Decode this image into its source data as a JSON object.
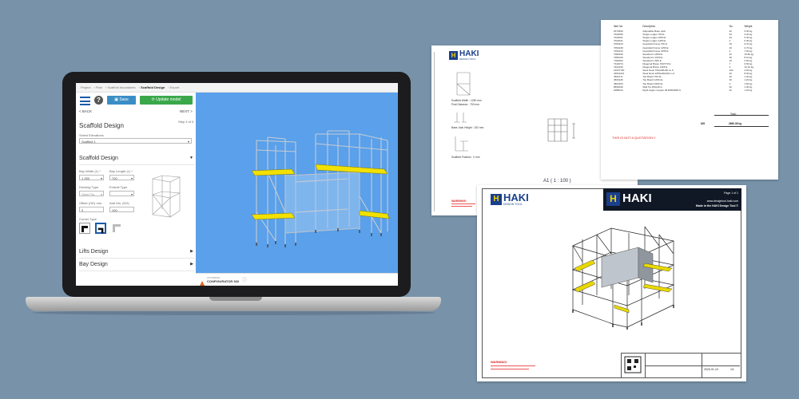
{
  "colors": {
    "background": "#7892a9",
    "viewport": "#5aa0ea",
    "save": "#3a8ec6",
    "update": "#3aa84a",
    "scaffold_yellow": "#f2e000",
    "haki_blue": "#1a3f8c"
  },
  "app": {
    "breadcrumb": [
      "Project",
      "Plan",
      "Scaffold boundaries",
      "Scaffold Design",
      "Export"
    ],
    "breadcrumb_current": "Scaffold Design",
    "save_label": "Save",
    "update_label": "Update model",
    "back_label": "< BACK",
    "next_label": "NEXT >",
    "step": "Step 4 of 5",
    "page_title": "Scaffold Design",
    "select_elevations_label": "Select Elevations",
    "select_elevations_value": "Scaffold 1",
    "section_scaffold": "Scaffold Design",
    "bay_width_label": "Bay Width (1) *",
    "bay_width_value": "1 250",
    "bay_length_label": "Bay Length (L) *",
    "bay_length_value": "700",
    "decking_label": "Decking Type",
    "decking_value": "Steel Pla",
    "endrail_label": "Endrail Type",
    "endrail_value": "",
    "offset_label": "Offset (OD) mm",
    "offset_value": "0",
    "add_dist_label": "Add Dis. (DH)",
    "add_dist_value": "100",
    "corner_label": "Corner Type",
    "section_lifts": "Lifts Design",
    "section_bay": "Bay Design",
    "footer_brand_top": "AUTODESK",
    "footer_brand": "CONFIGURATOR 360"
  },
  "doc_left": {
    "logo": "HAKI",
    "logo_sub": "DESIGN TOOL",
    "scaffold_width": "Scaffold Width : 1250 mm",
    "post_distance": "Post Distance : 700 mm",
    "base_jack": "Base Jack Height : 152 mm",
    "scaffold_position": "Scaffold Position : 0 mm",
    "warning": "WARNING!"
  },
  "doc_right": {
    "columns": [
      "Item No.",
      "Description",
      "No.",
      "Weight"
    ],
    "rows": [
      [
        "2073309",
        "Adjustable Base Jack",
        "42",
        "5.00 kg"
      ],
      [
        "7022066",
        "Single Ledger 700 E",
        "64",
        "3.30 kg"
      ],
      [
        "7022021",
        "Single Ledger 1050 E",
        "42",
        "5.40 kg"
      ],
      [
        "7022041",
        "Single Ledger 1250 E",
        "4",
        "6.30 kg"
      ],
      [
        "7052224",
        "Guardrail Frame 700 E",
        "16",
        "9.70 kg"
      ],
      [
        "7052228",
        "Guardrail Frame 1250 E",
        "16",
        "3.70 kg"
      ],
      [
        "7052244",
        "Guardrail Frame 1655 E",
        "2",
        "7.00 kg"
      ],
      [
        "7082030",
        "Standard 1 2000 E",
        "42",
        "10.80 kg"
      ],
      [
        "7081020",
        "Standard 1 1500 E",
        "26",
        "8.10 kg"
      ],
      [
        "7182094",
        "Standard 1 500 E",
        "16",
        "2.50 kg"
      ],
      [
        "7322074",
        "Diagonal Brace 700/770 E",
        "7",
        "6.50 kg"
      ],
      [
        "7322166",
        "Diagonal Brace 1465 E",
        "3",
        "10.10 kg"
      ],
      [
        "21537700",
        "Steel Deck 700x200x60 Ls 6",
        "102",
        "4.60 kg"
      ],
      [
        "23521021",
        "Steel Deck 1650x200x60 Ls 6",
        "32",
        "8.00 kg"
      ],
      [
        "4501471",
        "Toe Board 700 AL",
        "32",
        "1.20 kg"
      ],
      [
        "4503125",
        "Toe Board 1250 AL",
        "32",
        "1.20 kg"
      ],
      [
        "4503103",
        "Toe Board 1650 AL",
        "2",
        "1.50 kg"
      ],
      [
        "8552046",
        "Wall Tie 450x40 G",
        "42",
        "1.00 kg"
      ],
      [
        "2086013",
        "Right Angle Coupler 48 Ø48xØ48 G",
        "42",
        "1.20 kg"
      ]
    ],
    "total_label": "Total:",
    "total_count": "620",
    "total_weight": "2660.06 kg",
    "not_quotation": "THIS IS NOT A QUOTATION !!"
  },
  "doc_front": {
    "scale": "A1 ( 1 : 100 )",
    "logo": "HAKI",
    "logo_sub": "DESIGN TOOL",
    "banner_logo": "HAKI",
    "page": "Page 1 of 1",
    "site": "www.designtool.haki.com",
    "made": "Made in the HAKI Design Tool ©",
    "warning": "WARNING!",
    "date": "2020-01-10",
    "sheet": "1/1"
  }
}
